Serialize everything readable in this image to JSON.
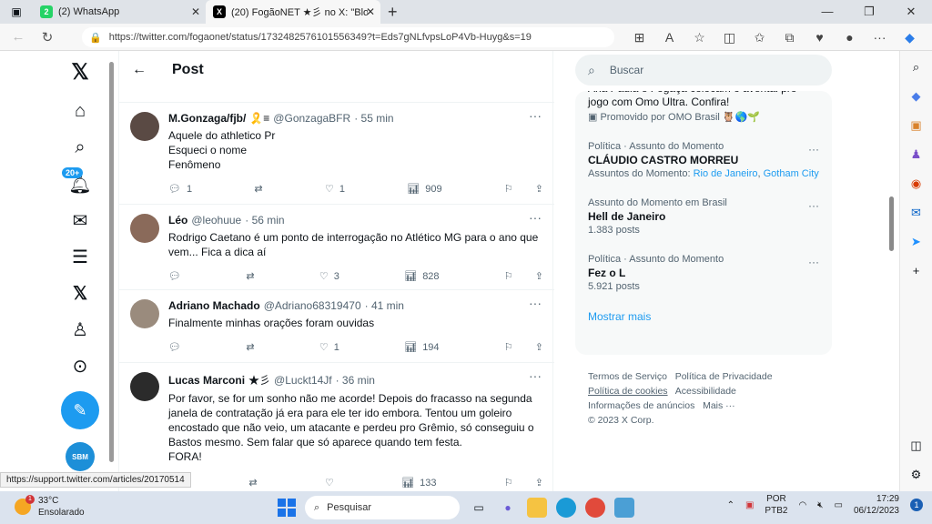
{
  "browser": {
    "tabs": [
      {
        "label": "(2) WhatsApp",
        "icon": "whatsapp-icon",
        "badge": "2"
      },
      {
        "label": "(20) FogãoNET ★彡 no X: \"Blog d",
        "icon": "x-logo-icon"
      }
    ],
    "url": "https://twitter.com/fogaonet/status/1732482576101556349?t=Eds7gNLfvpsLoP4Vb-Huyg&s=19"
  },
  "nav": {
    "notifications_badge": "20+",
    "sbm_label": "SBM"
  },
  "header": {
    "title": "Post"
  },
  "tweets": [
    {
      "name": "M.Gonzaga/fjb/",
      "emoji": "🎗️≡",
      "handle": "@GonzagaBFR",
      "time": "· 55 min",
      "text": [
        "Aquele do athletico Pr",
        "Esqueci o nome",
        "Fenômeno"
      ],
      "replies": "1",
      "likes": "1",
      "views": "909",
      "avatar_color": "#5a4a44"
    },
    {
      "name": "Léo",
      "emoji": "",
      "handle": "@leohuue",
      "time": "· 56 min",
      "text": [
        "Rodrigo Caetano é um ponto de interrogação no Atlético MG para o ano que vem... Fica a dica aí"
      ],
      "replies": "",
      "likes": "3",
      "views": "828",
      "avatar_color": "#8a6a5a"
    },
    {
      "name": "Adriano Machado",
      "emoji": "",
      "handle": "@Adriano68319470",
      "time": "· 41 min",
      "text": [
        "Finalmente minhas orações foram ouvidas"
      ],
      "replies": "",
      "likes": "1",
      "views": "194",
      "avatar_color": "#9a8b7d"
    },
    {
      "name": "Lucas Marconi",
      "emoji": "★彡",
      "handle": "@Luckt14Jf",
      "time": "· 36 min",
      "text": [
        "Por favor, se for um sonho não me acorde! Depois do fracasso na segunda janela de contratação já era para ele ter ido embora. Tentou um goleiro encostado que não veio, um atacante e perdeu pro Grêmio, só conseguiu o Bastos mesmo. Sem falar que só aparece quando tem festa.",
        "FORA!"
      ],
      "replies": "",
      "likes": "",
      "views": "133",
      "avatar_color": "#2b2b2b"
    }
  ],
  "right": {
    "search_placeholder": "Buscar",
    "promo_partial": "Ana Paula e Fogaça colocam o avental pro jogo com Omo Ultra. Confira!",
    "promo_by": "Promovido por OMO Brasil 🦉🌎🌱",
    "trends": [
      {
        "category": "Política · Assunto do Momento",
        "title": "CLÁUDIO CASTRO MORREU",
        "sub_prefix": "Assuntos do Momento: ",
        "sub_links": [
          "Rio de Janeiro",
          "Gotham City"
        ]
      },
      {
        "category": "Assunto do Momento em Brasil",
        "title": "Hell de Janeiro",
        "posts": "1.383 posts"
      },
      {
        "category": "Política · Assunto do Momento",
        "title": "Fez o L",
        "posts": "5.921 posts"
      }
    ],
    "show_more": "Mostrar mais",
    "footer": {
      "line1a": "Termos de Serviço",
      "line1b": "Política de Privacidade",
      "line2a": "Política de cookies",
      "line2b": "Acessibilidade",
      "line3a": "Informações de anúncios",
      "line3b": "Mais ···",
      "line4": "© 2023 X Corp."
    }
  },
  "status_url": "https://support.twitter.com/articles/20170514",
  "taskbar": {
    "temp": "33°C",
    "weather": "Ensolarado",
    "weather_badge": "1",
    "search": "Pesquisar",
    "lang1": "POR",
    "lang2": "PTB2",
    "time": "17:29",
    "date": "06/12/2023",
    "notif": "1"
  }
}
